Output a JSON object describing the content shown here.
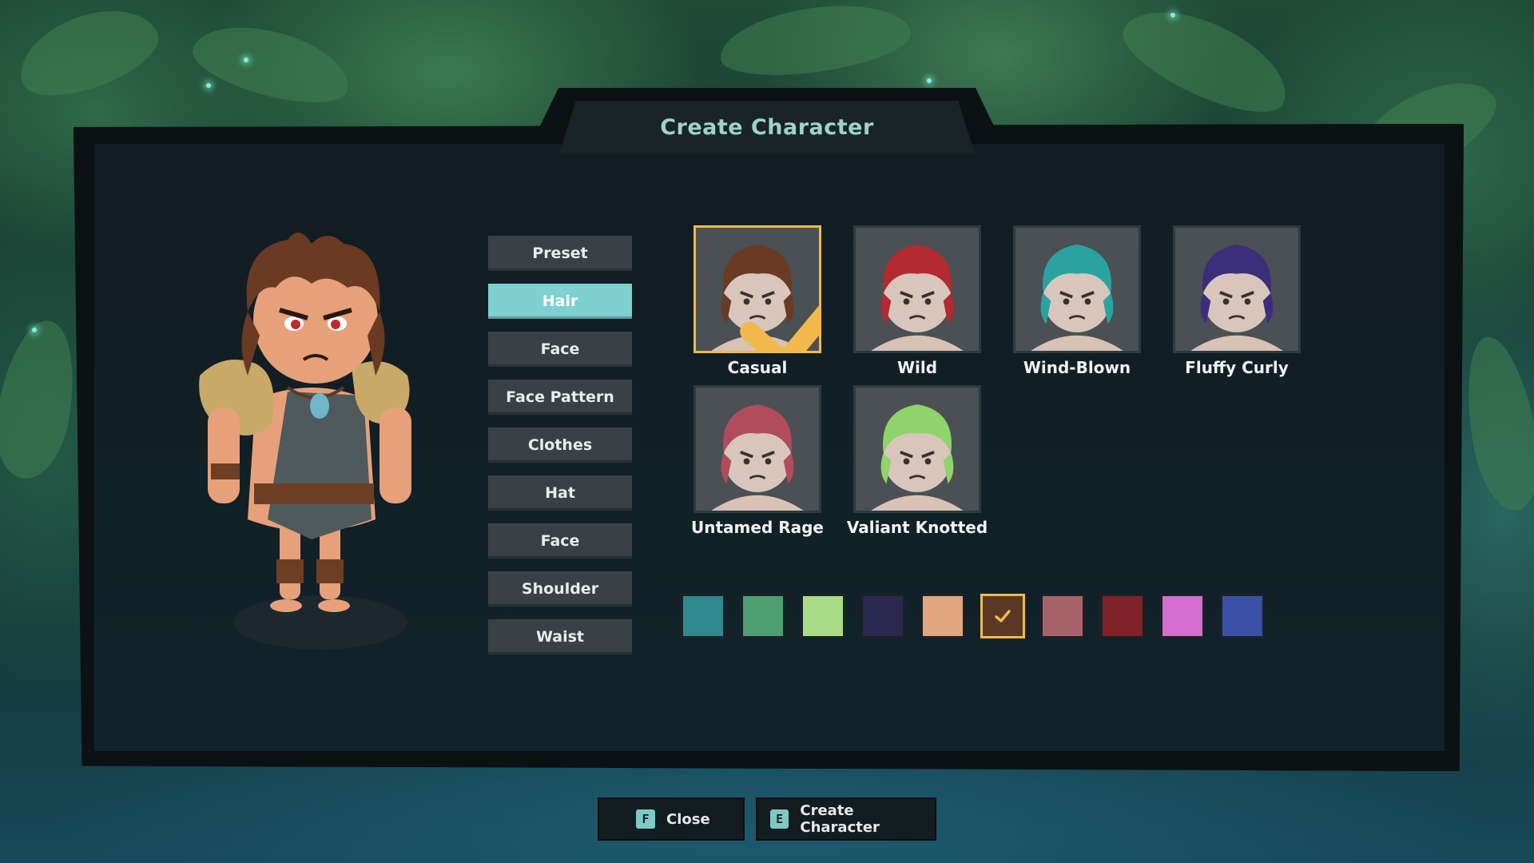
{
  "title": "Create Character",
  "menu": {
    "items": [
      {
        "label": "Preset",
        "active": false
      },
      {
        "label": "Hair",
        "active": true
      },
      {
        "label": "Face",
        "active": false
      },
      {
        "label": "Face Pattern",
        "active": false
      },
      {
        "label": "Clothes",
        "active": false
      },
      {
        "label": "Hat",
        "active": false
      },
      {
        "label": "Face",
        "active": false
      },
      {
        "label": "Shoulder",
        "active": false
      },
      {
        "label": "Waist",
        "active": false
      }
    ]
  },
  "hair_options": [
    {
      "label": "Casual",
      "hair_color": "#6b3a22",
      "selected": true
    },
    {
      "label": "Wild",
      "hair_color": "#b32a30",
      "selected": false
    },
    {
      "label": "Wind-Blown",
      "hair_color": "#2aa3a0",
      "selected": false
    },
    {
      "label": "Fluffy Curly",
      "hair_color": "#3c2f7a",
      "selected": false
    },
    {
      "label": "Untamed Rage",
      "hair_color": "#b14c5e",
      "selected": false
    },
    {
      "label": "Valiant Knotted",
      "hair_color": "#8fd36a",
      "selected": false
    }
  ],
  "colors": [
    {
      "hex": "#2f8a8f",
      "selected": false
    },
    {
      "hex": "#4e9e74",
      "selected": false
    },
    {
      "hex": "#a9dc86",
      "selected": false
    },
    {
      "hex": "#2b2850",
      "selected": false
    },
    {
      "hex": "#e3a57e",
      "selected": false
    },
    {
      "hex": "#5a3824",
      "selected": true
    },
    {
      "hex": "#a8636a",
      "selected": false
    },
    {
      "hex": "#7f2329",
      "selected": false
    },
    {
      "hex": "#d46fcf",
      "selected": false
    },
    {
      "hex": "#3b51a8",
      "selected": false
    }
  ],
  "buttons": {
    "close": {
      "key": "F",
      "label": "Close"
    },
    "create": {
      "key": "E",
      "label": "Create Character"
    }
  },
  "accent_colors": {
    "selected_border": "#f1b94b",
    "active_tab": "#7fd0d0",
    "title": "#9ed3c8"
  }
}
